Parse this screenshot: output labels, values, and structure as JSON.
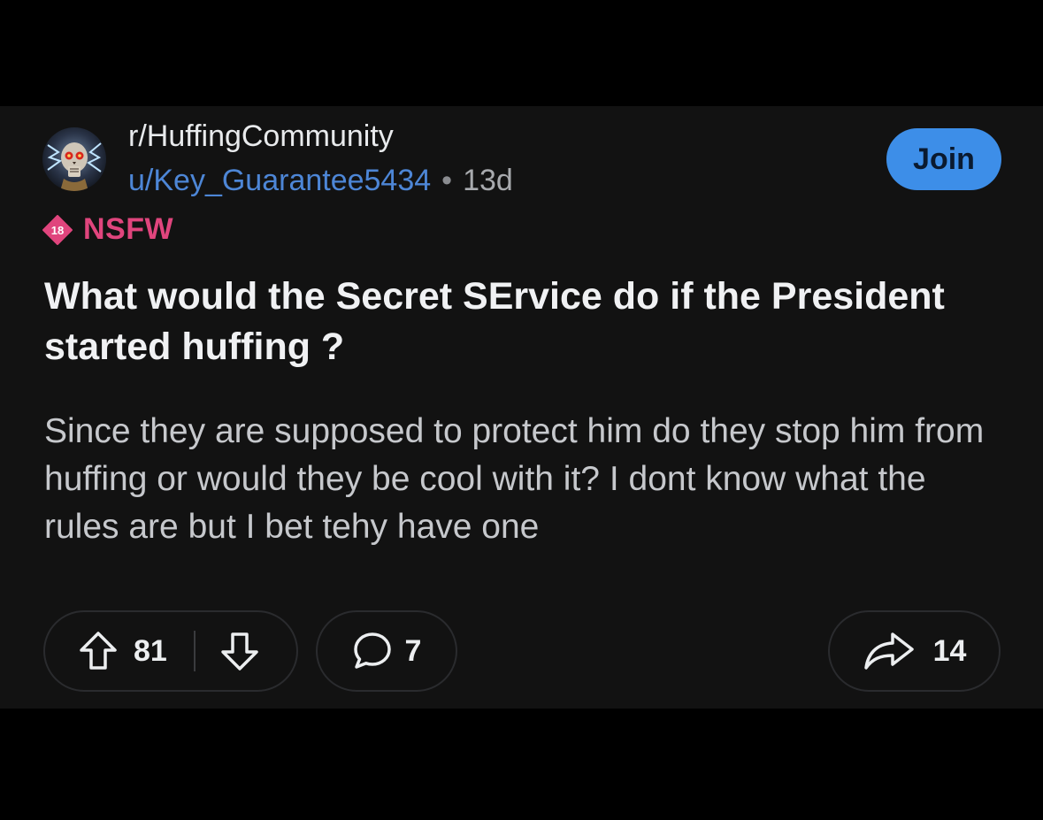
{
  "post": {
    "subreddit": "r/HuffingCommunity",
    "author": "u/Key_Guarantee5434",
    "separator": "•",
    "age": "13d",
    "join_label": "Join",
    "nsfw": {
      "badge_number": "18",
      "label": "NSFW"
    },
    "title": "What would the Secret SErvice do if the President started huffing ?",
    "body": "Since they are supposed to protect him do they stop him from huffing or would they be cool with it? I dont know what the rules are but I bet tehy have one"
  },
  "actions": {
    "upvote_count": "81",
    "comment_count": "7",
    "share_count": "14"
  },
  "icons": {
    "avatar": "skull-avatar-icon",
    "nsfw": "nsfw-18-icon",
    "upvote": "upvote-arrow-icon",
    "downvote": "downvote-arrow-icon",
    "comment": "comment-bubble-icon",
    "share": "share-arrow-icon"
  },
  "colors": {
    "background": "#000000",
    "card": "#121212",
    "username": "#4d86d6",
    "join_button": "#3d8ee8",
    "nsfw": "#e0457d"
  }
}
